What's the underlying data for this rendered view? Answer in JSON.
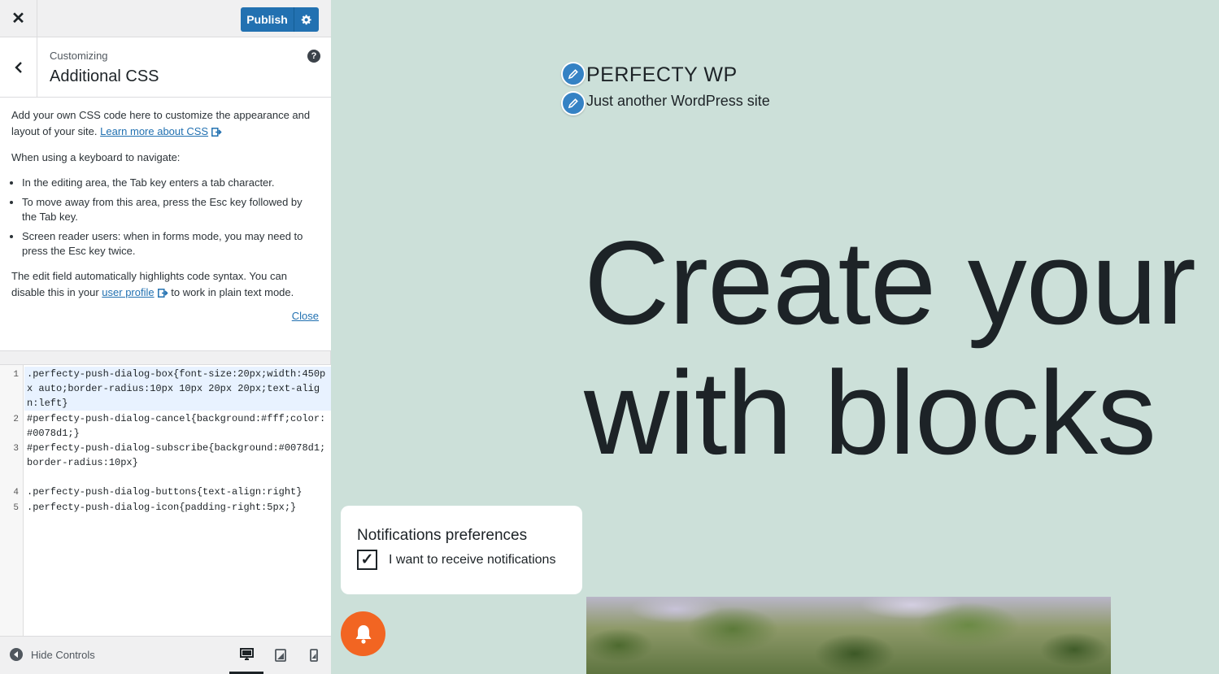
{
  "topbar": {
    "close_label": "✕",
    "publish_label": "Publish"
  },
  "section": {
    "breadcrumb": "Customizing",
    "title": "Additional CSS",
    "help_label": "?"
  },
  "description": {
    "intro": "Add your own CSS code here to customize the appearance and layout of your site.",
    "learn_more_link": "Learn more about CSS",
    "keyboard_heading": "When using a keyboard to navigate:",
    "tips": [
      "In the editing area, the Tab key enters a tab character.",
      "To move away from this area, press the Esc key followed by the Tab key.",
      "Screen reader users: when in forms mode, you may need to press the Esc key twice."
    ],
    "syntax_text_before": "The edit field automatically highlights code syntax. You can disable this in your",
    "user_profile_link": "user profile",
    "syntax_text_after": "to work in plain text mode.",
    "close_link": "Close"
  },
  "editor": {
    "line_numbers": [
      "1",
      "2",
      "3",
      "4",
      "5"
    ],
    "lines": [
      ".perfecty-push-dialog-box{font-size:20px;width:450px auto;border-radius:10px 10px 20px 20px;text-align:left}",
      "#perfecty-push-dialog-cancel{background:#fff;color:#0078d1;}",
      "#perfecty-push-dialog-subscribe{background:#0078d1;border-radius:10px}",
      ".perfecty-push-dialog-buttons{text-align:right}",
      ".perfecty-push-dialog-icon{padding-right:5px;}"
    ]
  },
  "footer": {
    "hide_controls_label": "Hide Controls",
    "devices": [
      "desktop-icon",
      "tablet-icon",
      "mobile-icon"
    ],
    "active_device": "desktop"
  },
  "preview": {
    "site_title": "PERFECTY WP",
    "site_tagline": "Just another WordPress site",
    "hero_line_1": "Create your w",
    "hero_line_2": "with blocks",
    "notification_title": "Notifications preferences",
    "notification_checkbox_label": "I want to receive notifications",
    "notification_checked": true,
    "checkmark": "✓"
  },
  "colors": {
    "accent": "#2271b1",
    "preview_bg": "#cce0d9",
    "bell": "#f26522",
    "edit_shortcut": "#3582c4"
  }
}
